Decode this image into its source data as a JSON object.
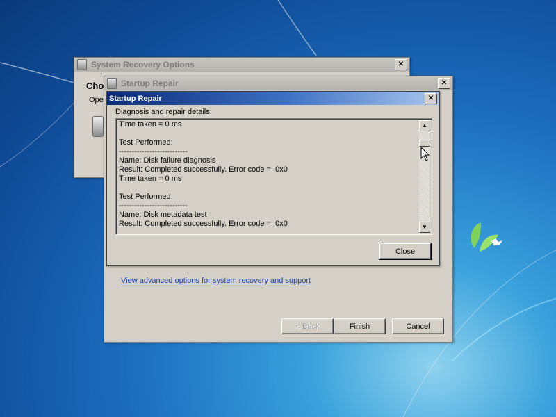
{
  "back_window": {
    "title": "System Recovery Options",
    "heading_fragment": "Cho",
    "text_fragment": "Ope"
  },
  "mid_window": {
    "title": "Startup Repair",
    "advanced_link": "View advanced options for system recovery and support",
    "back_label": "< Back",
    "finish_label": "Finish",
    "cancel_label": "Cancel"
  },
  "details_dialog": {
    "title": "Startup Repair",
    "section_label": "Diagnosis and repair details:",
    "log_lines": [
      "Time taken = 0 ms",
      "",
      "Test Performed:",
      "---------------------------",
      "Name: Disk failure diagnosis",
      "Result: Completed successfully. Error code =  0x0",
      "Time taken = 0 ms",
      "",
      "Test Performed:",
      "---------------------------",
      "Name: Disk metadata test",
      "Result: Completed successfully. Error code =  0x0"
    ],
    "close_label": "Close",
    "scroll_position": 0.1
  },
  "icons": {
    "window": "app-window-icon",
    "close": "close-icon",
    "scroll_up": "scroll-up-arrow-icon",
    "scroll_down": "scroll-down-arrow-icon",
    "cursor": "mouse-pointer-icon",
    "desktop_logo": "windows-leaf-logo-icon"
  },
  "colors": {
    "active_title": "#0a2a78",
    "dialog_face": "#d4d0c8",
    "link": "#1a3fb0"
  }
}
